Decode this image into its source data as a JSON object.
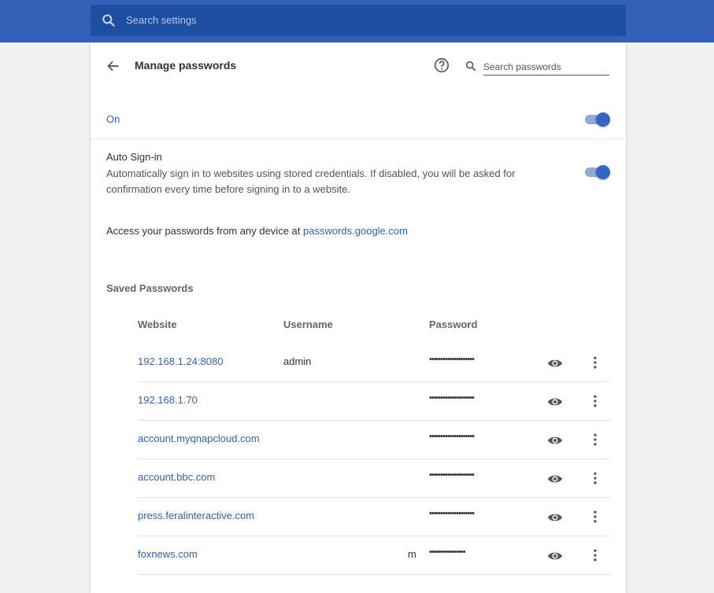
{
  "top_bar": {
    "search_placeholder": "Search settings",
    "search_icon": "search-icon",
    "color": "#3461b7"
  },
  "header": {
    "title": "Manage passwords",
    "back_icon": "back-arrow-icon",
    "help_icon": "help-icon",
    "search_placeholder": "Search passwords"
  },
  "offer_to_save": {
    "label": "On",
    "enabled": true
  },
  "auto_signin": {
    "title": "Auto Sign-in",
    "description": "Automatically sign in to websites using stored credentials. If disabled, you will be asked for confirmation every time before signing in to a website.",
    "enabled": true
  },
  "access": {
    "text": "Access your passwords from any device at ",
    "link": "passwords.google.com"
  },
  "saved": {
    "heading": "Saved Passwords",
    "columns": {
      "website": "Website",
      "username": "Username",
      "password": "Password"
    },
    "rows": [
      {
        "website": "192.168.1.24:8080",
        "username": "admin",
        "password": "••••••••••••••••••••"
      },
      {
        "website": "192.168.1.70",
        "username": "",
        "password": "••••••••••••••••••••"
      },
      {
        "website": "account.myqnapcloud.com",
        "username": "",
        "password": "••••••••••••••••••••"
      },
      {
        "website": "account.bbc.com",
        "username": "",
        "password": "••••••••••••••••••••"
      },
      {
        "website": "press.feralinteractive.com",
        "username": "",
        "password": "••••••••••••••••••••"
      },
      {
        "website": "foxnews.com",
        "username": "m",
        "password": "••••••••••••••••"
      }
    ]
  },
  "colors": {
    "accent": "#3461b7",
    "toggle_knob": "#3465c2",
    "toggle_track": "#8fa9d8"
  }
}
